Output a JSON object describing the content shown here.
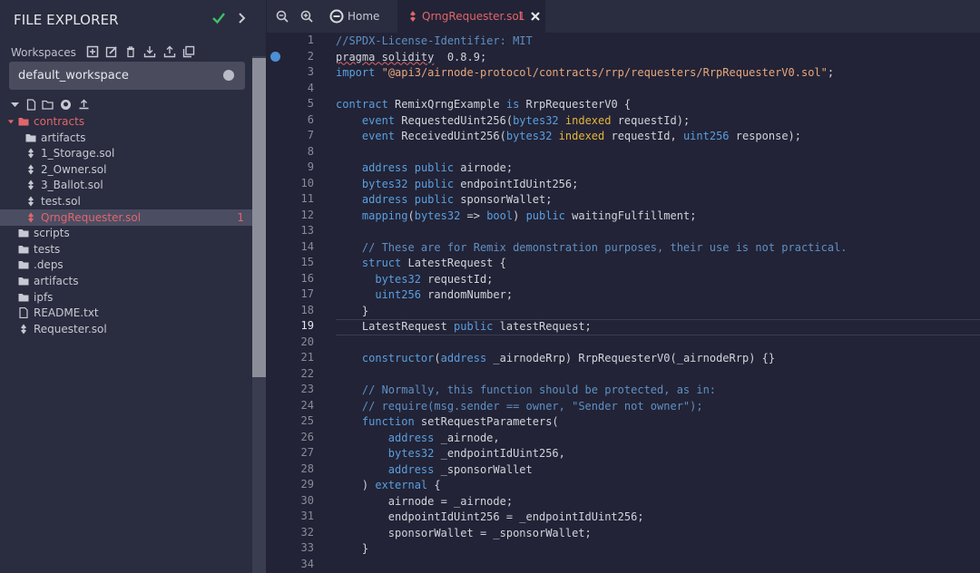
{
  "sidebar": {
    "title": "FILE EXPLORER",
    "workspaces_label": "Workspaces",
    "workspace_selected": "default_workspace",
    "tree": [
      {
        "label": "contracts",
        "type": "folder",
        "indent": 0,
        "state": "red"
      },
      {
        "label": "artifacts",
        "type": "folder",
        "indent": 1
      },
      {
        "label": "1_Storage.sol",
        "type": "sol",
        "indent": 1
      },
      {
        "label": "2_Owner.sol",
        "type": "sol",
        "indent": 1
      },
      {
        "label": "3_Ballot.sol",
        "type": "sol",
        "indent": 1
      },
      {
        "label": "test.sol",
        "type": "sol",
        "indent": 1
      },
      {
        "label": "QrngRequester.sol",
        "type": "sol",
        "indent": 1,
        "state": "active",
        "badge": "1"
      },
      {
        "label": "scripts",
        "type": "folder",
        "indent": 0
      },
      {
        "label": "tests",
        "type": "folder",
        "indent": 0
      },
      {
        "label": ".deps",
        "type": "folder",
        "indent": 0
      },
      {
        "label": "artifacts",
        "type": "folder",
        "indent": 0
      },
      {
        "label": "ipfs",
        "type": "folder",
        "indent": 0
      },
      {
        "label": "README.txt",
        "type": "file",
        "indent": 0
      },
      {
        "label": "Requester.sol",
        "type": "sol",
        "indent": 0
      }
    ]
  },
  "tabs": {
    "home_label": "Home",
    "active_label": "QrngRequester.sol",
    "active_badge": "1"
  },
  "editor": {
    "current_line": 19,
    "lines": [
      [
        [
          "cmt",
          "//SPDX-License-Identifier: MIT"
        ]
      ],
      [
        [
          "squig",
          "pragma solidity"
        ],
        [
          "",
          "  0.8.9;"
        ]
      ],
      [
        [
          "kw",
          "import"
        ],
        [
          "",
          " "
        ],
        [
          "str",
          "\"@api3/airnode-protocol/contracts/rrp/requesters/RrpRequesterV0.sol\""
        ],
        [
          "",
          ";"
        ]
      ],
      [],
      [
        [
          "kw",
          "contract"
        ],
        [
          "",
          " RemixQrngExample "
        ],
        [
          "kw",
          "is"
        ],
        [
          "",
          " RrpRequesterV0 {"
        ]
      ],
      [
        [
          "",
          "    "
        ],
        [
          "kw",
          "event"
        ],
        [
          "",
          " RequestedUint256("
        ],
        [
          "kw",
          "bytes32"
        ],
        [
          "",
          " "
        ],
        [
          "idx",
          "indexed"
        ],
        [
          "",
          " requestId);"
        ]
      ],
      [
        [
          "",
          "    "
        ],
        [
          "kw",
          "event"
        ],
        [
          "",
          " ReceivedUint256("
        ],
        [
          "kw",
          "bytes32"
        ],
        [
          "",
          " "
        ],
        [
          "idx",
          "indexed"
        ],
        [
          "",
          " requestId, "
        ],
        [
          "kw",
          "uint256"
        ],
        [
          "",
          " response);"
        ]
      ],
      [],
      [
        [
          "",
          "    "
        ],
        [
          "kw",
          "address"
        ],
        [
          "",
          " "
        ],
        [
          "kw",
          "public"
        ],
        [
          "",
          " airnode;"
        ]
      ],
      [
        [
          "",
          "    "
        ],
        [
          "kw",
          "bytes32"
        ],
        [
          "",
          " "
        ],
        [
          "kw",
          "public"
        ],
        [
          "",
          " endpointIdUint256;"
        ]
      ],
      [
        [
          "",
          "    "
        ],
        [
          "kw",
          "address"
        ],
        [
          "",
          " "
        ],
        [
          "kw",
          "public"
        ],
        [
          "",
          " sponsorWallet;"
        ]
      ],
      [
        [
          "",
          "    "
        ],
        [
          "kw",
          "mapping"
        ],
        [
          "",
          "("
        ],
        [
          "kw",
          "bytes32"
        ],
        [
          "",
          " => "
        ],
        [
          "kw",
          "bool"
        ],
        [
          "",
          ") "
        ],
        [
          "kw",
          "public"
        ],
        [
          "",
          " waitingFulfillment;"
        ]
      ],
      [],
      [
        [
          "",
          "    "
        ],
        [
          "cmt",
          "// These are for Remix demonstration purposes, their use is not practical."
        ]
      ],
      [
        [
          "",
          "    "
        ],
        [
          "kw",
          "struct"
        ],
        [
          "",
          " LatestRequest {"
        ]
      ],
      [
        [
          "",
          "      "
        ],
        [
          "kw",
          "bytes32"
        ],
        [
          "",
          " requestId;"
        ]
      ],
      [
        [
          "",
          "      "
        ],
        [
          "kw",
          "uint256"
        ],
        [
          "",
          " randomNumber;"
        ]
      ],
      [
        [
          "",
          "    }"
        ]
      ],
      [
        [
          "",
          "    LatestRequest "
        ],
        [
          "kw",
          "public"
        ],
        [
          "",
          " latestRequest;"
        ]
      ],
      [],
      [
        [
          "",
          "    "
        ],
        [
          "kw",
          "constructor"
        ],
        [
          "",
          "("
        ],
        [
          "kw",
          "address"
        ],
        [
          "",
          " _airnodeRrp) RrpRequesterV0(_airnodeRrp) {}"
        ]
      ],
      [],
      [
        [
          "",
          "    "
        ],
        [
          "cmt",
          "// Normally, this function should be protected, as in:"
        ]
      ],
      [
        [
          "",
          "    "
        ],
        [
          "cmt",
          "// require(msg.sender == owner, \"Sender not owner\");"
        ]
      ],
      [
        [
          "",
          "    "
        ],
        [
          "kw",
          "function"
        ],
        [
          "",
          " setRequestParameters("
        ]
      ],
      [
        [
          "",
          "        "
        ],
        [
          "kw",
          "address"
        ],
        [
          "",
          " _airnode,"
        ]
      ],
      [
        [
          "",
          "        "
        ],
        [
          "kw",
          "bytes32"
        ],
        [
          "",
          " _endpointIdUint256,"
        ]
      ],
      [
        [
          "",
          "        "
        ],
        [
          "kw",
          "address"
        ],
        [
          "",
          " _sponsorWallet"
        ]
      ],
      [
        [
          "",
          "    ) "
        ],
        [
          "kw",
          "external"
        ],
        [
          "",
          " {"
        ]
      ],
      [
        [
          "",
          "        airnode = _airnode;"
        ]
      ],
      [
        [
          "",
          "        endpointIdUint256 = _endpointIdUint256;"
        ]
      ],
      [
        [
          "",
          "        sponsorWallet = _sponsorWallet;"
        ]
      ],
      [
        [
          "",
          "    }"
        ]
      ],
      []
    ]
  }
}
